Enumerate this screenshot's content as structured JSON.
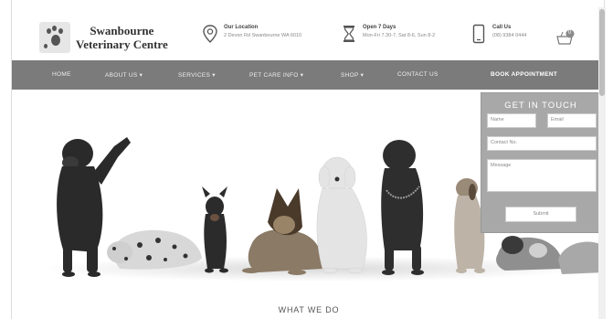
{
  "brand": {
    "name_line1": "Swanbourne",
    "name_line2": "Veterinary Centre"
  },
  "header": {
    "location": {
      "title": "Our Location",
      "value": "2 Devon Rd Swanbourne WA 6010"
    },
    "hours": {
      "title": "Open 7 Days",
      "value": "Mon-Fri 7.30-7, Sat 8-6, Sun 8-2"
    },
    "call": {
      "title": "Call Us",
      "value": "(08) 9384 0444"
    },
    "cart_count": "0"
  },
  "nav": {
    "items": [
      "HOME",
      "ABOUT US ▾",
      "SERVICES ▾",
      "PET CARE INFO ▾",
      "SHOP ▾",
      "CONTACT US"
    ],
    "book": "BOOK APPOINTMENT"
  },
  "contact_form": {
    "title": "GET IN TOUCH",
    "name_placeholder": "Name",
    "email_placeholder": "Email",
    "phone_placeholder": "Contact No.",
    "message_placeholder": "Message",
    "submit_label": "Submit"
  },
  "section": {
    "title": "WHAT WE DO"
  },
  "colors": {
    "nav_bg": "#7b7b7b",
    "panel_bg": "#a8a8a8",
    "text": "#444444"
  }
}
